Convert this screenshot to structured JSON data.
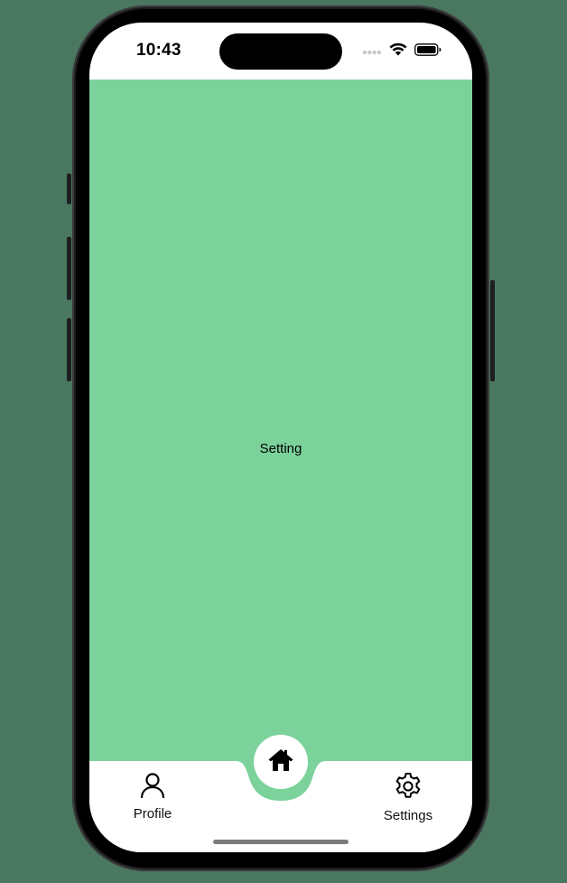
{
  "status_bar": {
    "time": "10:43"
  },
  "screen": {
    "center_text": "Setting",
    "background_color": "#7bd29b"
  },
  "tab_bar": {
    "items": [
      {
        "label": "Profile",
        "icon": "person-icon"
      },
      {
        "label": "",
        "icon": "home-icon"
      },
      {
        "label": "Settings",
        "icon": "gear-icon"
      }
    ]
  }
}
